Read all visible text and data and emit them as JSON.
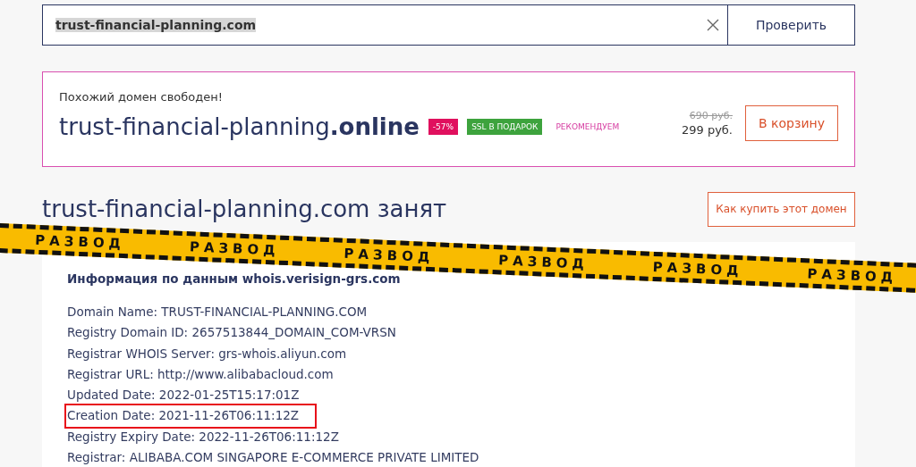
{
  "search": {
    "value": "trust-financial-planning.com",
    "text_selected": true,
    "button": "Проверить"
  },
  "offer": {
    "note": "Похожий домен свободен!",
    "domain": "trust-financial-planning**.online**",
    "badges": [
      {
        "kind": "discount",
        "label": "-57%"
      },
      {
        "kind": "gift",
        "label": "SSL В ПОДАРОК"
      },
      {
        "kind": "recommend",
        "label": "РЕКОМЕНДУЕМ"
      }
    ],
    "old_price": "690 руб.",
    "price": "299 руб.",
    "button": "В корзину"
  },
  "status": {
    "title": "trust-financial-planning.com занят",
    "button": "Как купить этот домен"
  },
  "whois": {
    "title": "Информация по данным whois.verisign-grs.com",
    "lines": [
      {
        "text": "Domain Name: TRUST-FINANCIAL-PLANNING.COM",
        "highlighted": false
      },
      {
        "text": "Registry Domain ID: 2657513844_DOMAIN_COM-VRSN",
        "highlighted": false
      },
      {
        "text": "Registrar WHOIS Server: grs-whois.aliyun.com",
        "highlighted": false
      },
      {
        "text": "Registrar URL: http://www.alibabacloud.com",
        "highlighted": false
      },
      {
        "text": "Updated Date: 2022-01-25T15:17:01Z",
        "highlighted": false
      },
      {
        "text": "Creation Date: 2021-11-26T06:11:12Z",
        "highlighted": true
      },
      {
        "text": "Registry Expiry Date: 2022-11-26T06:11:12Z",
        "highlighted": false
      },
      {
        "text": "Registrar: ALIBABA.COM SINGAPORE E-COMMERCE PRIVATE LIMITED",
        "highlighted": false
      }
    ]
  },
  "tape": {
    "labels": [
      "РАЗВОД",
      "РАЗВОД",
      "РАЗВОД",
      "РАЗВОД",
      "РАЗВОД",
      "РАЗВОД"
    ]
  }
}
